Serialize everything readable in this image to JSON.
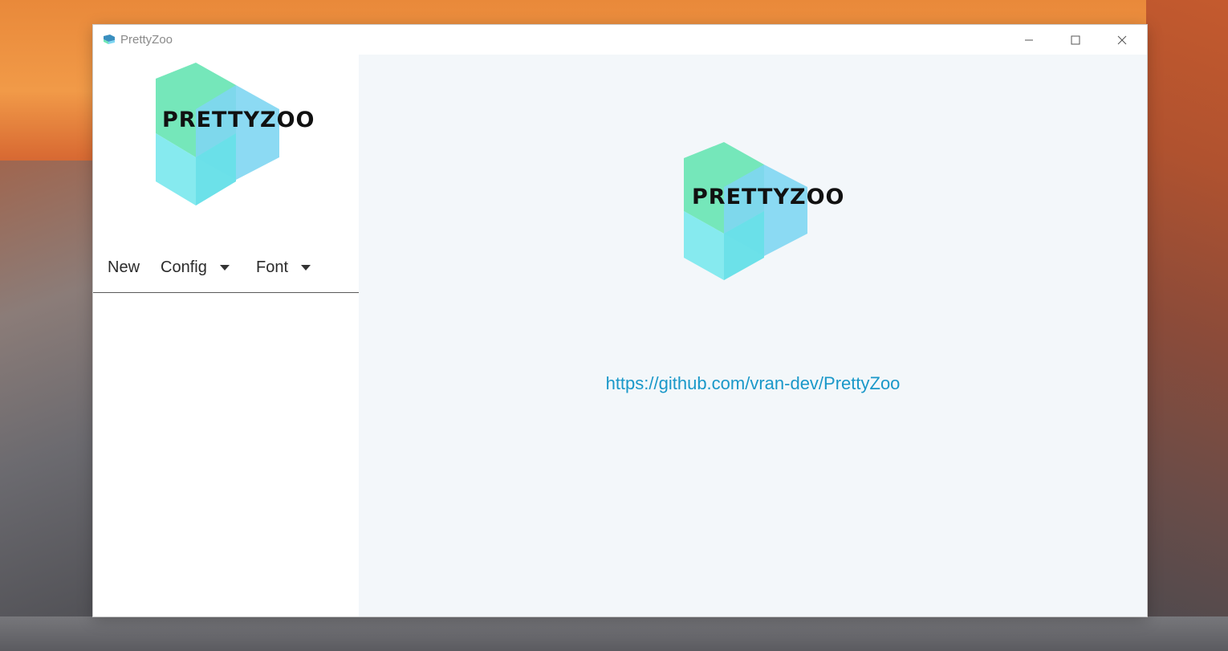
{
  "window": {
    "title": "PrettyZoo",
    "controls": {
      "minimize_icon": "minimize-icon",
      "maximize_icon": "maximize-icon",
      "close_icon": "close-icon"
    }
  },
  "sidebar": {
    "logo_text": "PRETTYZOO",
    "toolbar": {
      "new_label": "New",
      "config_label": "Config",
      "font_label": "Font"
    },
    "servers": []
  },
  "main": {
    "logo_text": "PRETTYZOO",
    "link": "https://github.com/vran-dev/PrettyZoo"
  },
  "colors": {
    "link": "#1a98c9",
    "main_background": "#f3f7fa",
    "logo_green": "#6ee6b6",
    "logo_cyan": "#7fe9ee",
    "logo_blue": "#7fd6f2"
  }
}
